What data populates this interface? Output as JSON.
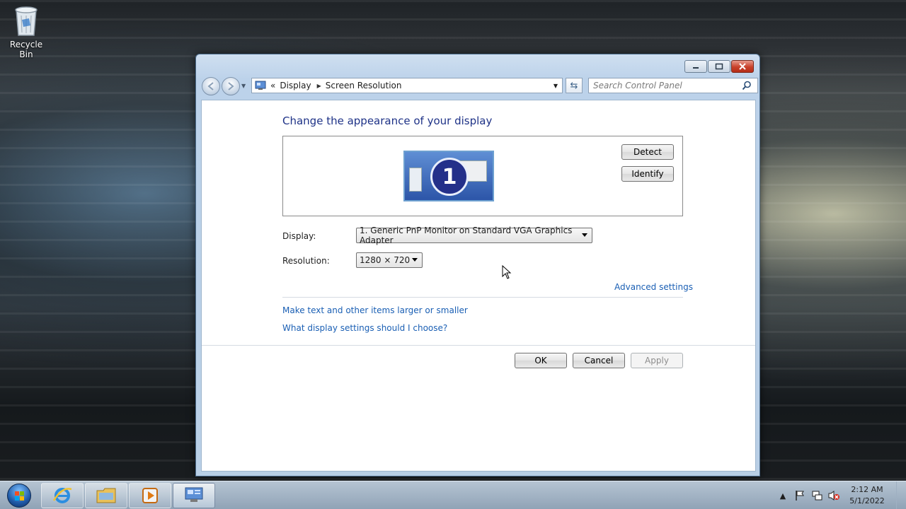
{
  "desktop": {
    "recycle_bin_label": "Recycle Bin"
  },
  "window": {
    "address": {
      "overflow": "«",
      "crumbs": [
        "Display",
        "Screen Resolution"
      ]
    },
    "search_placeholder": "Search Control Panel"
  },
  "content": {
    "heading": "Change the appearance of your display",
    "monitor_number": "1",
    "detect_label": "Detect",
    "identify_label": "Identify",
    "display_label": "Display:",
    "display_value": "1. Generic PnP Monitor on Standard VGA Graphics Adapter",
    "resolution_label": "Resolution:",
    "resolution_value": "1280 × 720",
    "advanced_settings": "Advanced settings",
    "link_text_size": "Make text and other items larger or smaller",
    "link_help": "What display settings should I choose?",
    "ok_label": "OK",
    "cancel_label": "Cancel",
    "apply_label": "Apply"
  },
  "taskbar": {
    "items": [
      "start-orb",
      "internet-explorer-icon",
      "windows-explorer-icon",
      "media-player-icon",
      "control-panel-icon"
    ],
    "clock_time": "2:12 AM",
    "clock_date": "5/1/2022"
  },
  "colors": {
    "heading": "#1e3287",
    "link": "#1a5fb4",
    "window_frame": "#bcd2ea"
  }
}
